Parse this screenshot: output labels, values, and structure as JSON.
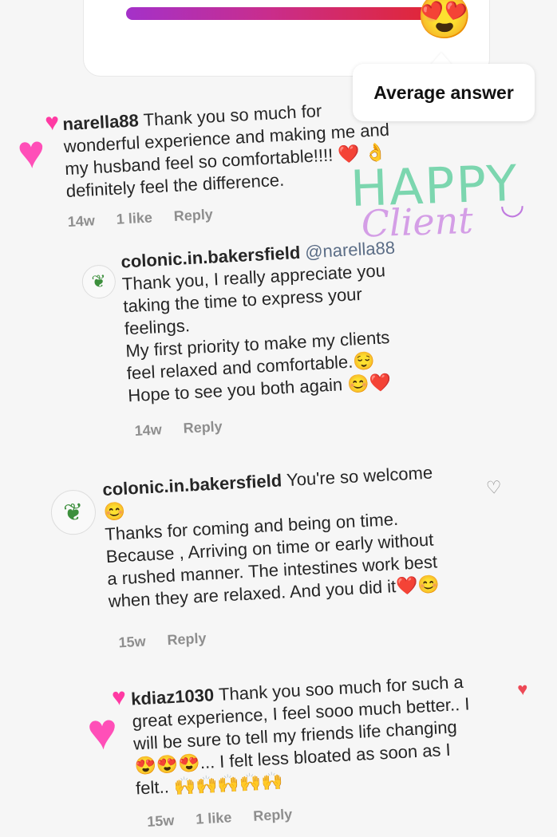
{
  "poll": {
    "slider_emoji": "😍",
    "tooltip": "Average answer",
    "gradient": [
      "#a431c9",
      "#e3262f"
    ]
  },
  "sticker": {
    "line1": "HAPPY",
    "line2": "Client"
  },
  "comments": [
    {
      "username": "narella88",
      "text_lines": [
        "Thank you so much for",
        "wonderful experience and making me and",
        "my husband feel so comfortable!!!! ❤️ 👌",
        "definitely feel the difference."
      ],
      "time": "14w",
      "likes": "1 like",
      "reply": "Reply"
    },
    {
      "username": "colonic.in.bakersfield",
      "mention": "@narella88",
      "text_lines": [
        "Thank you, I really appreciate you",
        "taking the time to express your",
        "feelings.",
        "My first priority to make my clients",
        "feel relaxed and comfortable.😌",
        "Hope to see you both again 😊❤️"
      ],
      "time": "14w",
      "reply": "Reply"
    },
    {
      "username": "colonic.in.bakersfield",
      "text_lines": [
        "You're so welcome",
        "😊",
        "Thanks for coming and being on time.",
        "Because , Arriving on time or early without",
        "a rushed manner. The intestines work best",
        "when they are relaxed. And you did it❤️😊"
      ],
      "time": "15w",
      "reply": "Reply",
      "liked": false
    },
    {
      "username": "kdiaz1030",
      "text_lines": [
        "Thank you soo much for such a",
        "great experience, I feel sooo much better.. I",
        "will be sure to tell my friends life changing",
        "😍😍😍... I felt less bloated as soon as I",
        "felt.. 🙌🙌🙌🙌🙌"
      ],
      "time": "15w",
      "likes": "1 like",
      "reply": "Reply",
      "liked": true
    }
  ]
}
